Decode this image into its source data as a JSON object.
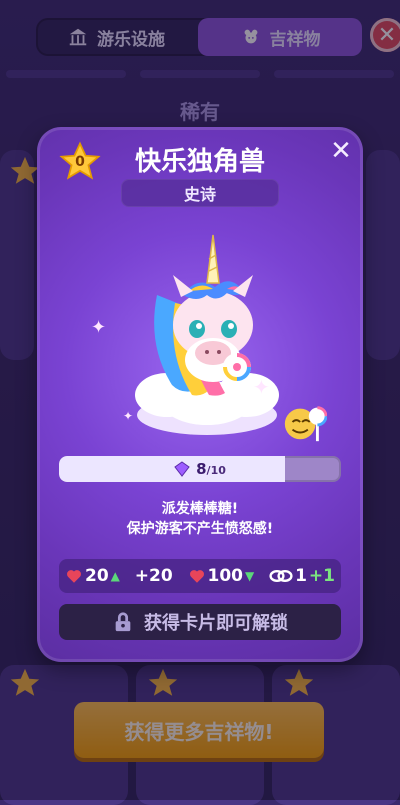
{
  "header": {
    "tabs": [
      {
        "label": "游乐设施",
        "icon": "pavilion-icon"
      },
      {
        "label": "吉祥物",
        "icon": "mascot-icon",
        "selected": true
      }
    ],
    "close_icon": "close-icon",
    "close_glyph": "✕"
  },
  "background": {
    "section_title": "稀有",
    "cta_label": "获得更多吉祥物!",
    "star_level": "1"
  },
  "modal": {
    "level_badge": "0",
    "title": "快乐独角兽",
    "close_glyph": "✕",
    "rarity": "史诗",
    "progress": {
      "current": "8",
      "max": "/10",
      "fraction": 0.8
    },
    "description_lines": [
      "派发棒棒糖!",
      "保护游客不产生愤怒感!"
    ],
    "stats": [
      {
        "icon": "heart-icon",
        "value": "20",
        "trend": "▲"
      },
      {
        "value": "+20"
      },
      {
        "icon": "heart-icon",
        "value": "100",
        "trend": "▼"
      },
      {
        "icon": "link-icon",
        "value": "1",
        "extra": "+1"
      }
    ],
    "unlock_label": "获得卡片即可解锁"
  },
  "colors": {
    "accent_purple": "#8b54d9",
    "cta_orange": "#f5a100",
    "heart_red": "#e8455a",
    "trend_green": "#5cd87a"
  }
}
